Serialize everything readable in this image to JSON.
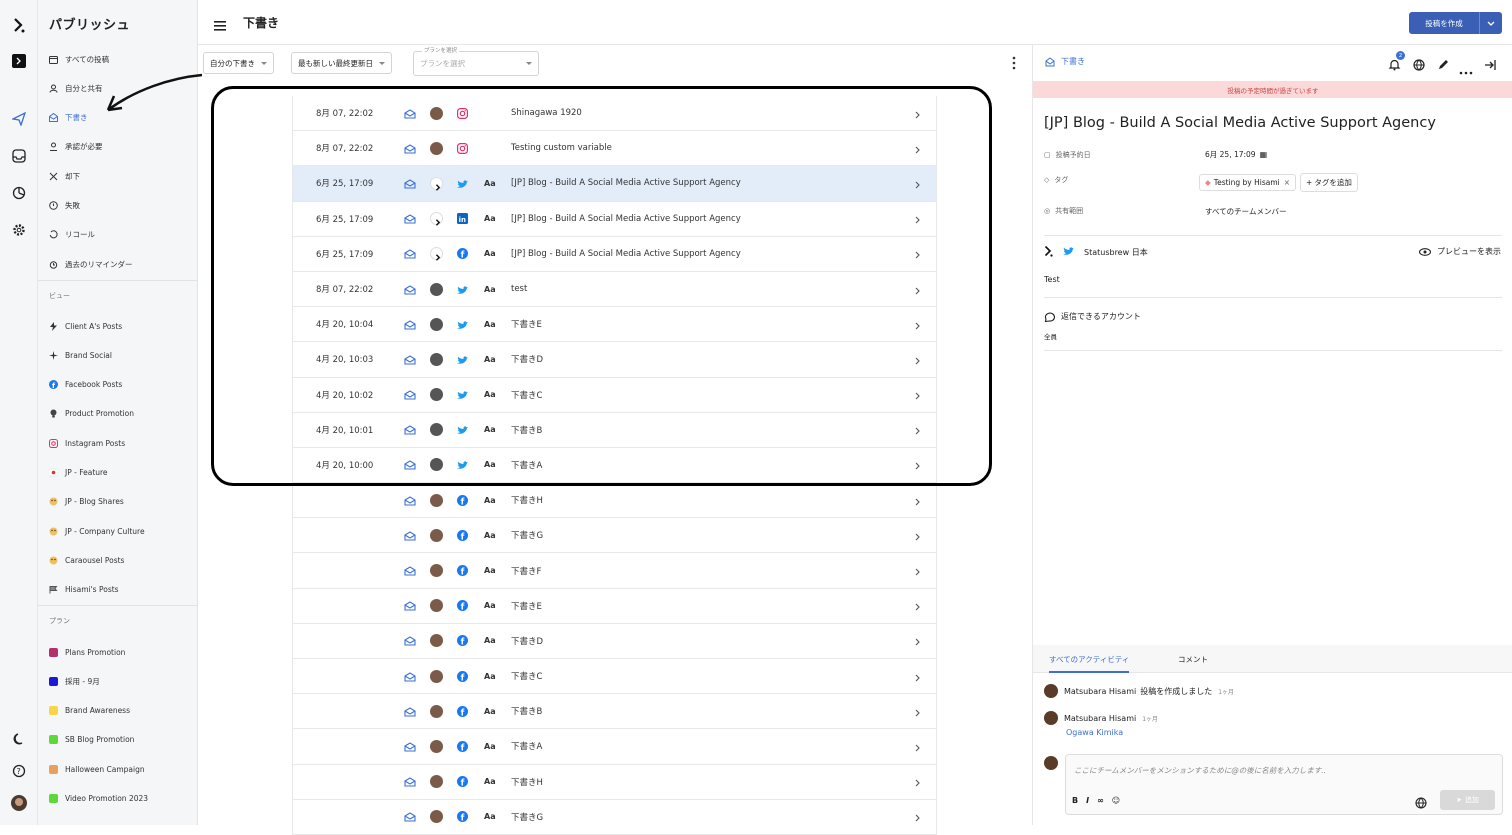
{
  "app": {
    "title": "パブリッシュ"
  },
  "rail": {
    "icons": [
      "statusbrew-logo-icon",
      "account-badge-icon",
      "paper-plane-icon",
      "inbox-icon",
      "analytics-icon",
      "settings-icon",
      "moon-icon",
      "help-icon",
      "user-avatar"
    ]
  },
  "sidebar": {
    "items": [
      {
        "label": "すべての投稿",
        "icon": "calendar-icon"
      },
      {
        "label": "自分と共有",
        "icon": "person-icon"
      },
      {
        "label": "下書き",
        "icon": "draft-icon",
        "active": true
      },
      {
        "label": "承認が必要",
        "icon": "approval-icon"
      },
      {
        "label": "却下",
        "icon": "x-icon"
      },
      {
        "label": "失敗",
        "icon": "alert-icon"
      },
      {
        "label": "リコール",
        "icon": "recall-icon"
      },
      {
        "label": "過去のリマインダー",
        "icon": "alarm-icon"
      }
    ],
    "views_heading": "ビュー",
    "views": [
      {
        "label": "Client A's Posts",
        "icon": "bolt-icon"
      },
      {
        "label": "Brand Social",
        "icon": "sparkle-icon"
      },
      {
        "label": "Facebook Posts",
        "icon": "facebook-icon"
      },
      {
        "label": "Product Promotion",
        "icon": "bulb-icon"
      },
      {
        "label": "Instagram Posts",
        "icon": "instagram-icon"
      },
      {
        "label": "JP - Feature",
        "icon": "japan-flag-icon"
      },
      {
        "label": "JP - Blog Shares",
        "icon": "emoji-icon"
      },
      {
        "label": "JP - Company Culture",
        "icon": "emoji-icon"
      },
      {
        "label": "Caraousel Posts",
        "icon": "emoji-icon"
      },
      {
        "label": "Hisami's Posts",
        "icon": "flag-icon"
      }
    ],
    "plans_heading": "プラン",
    "plans": [
      {
        "label": "Plans Promotion",
        "color": "#b3306e"
      },
      {
        "label": "採用 - 9月",
        "color": "#1a1ad6"
      },
      {
        "label": "Brand Awareness",
        "color": "#f7d44a"
      },
      {
        "label": "SB Blog Promotion",
        "color": "#5fd63a"
      },
      {
        "label": "Halloween Campaign",
        "color": "#e8a060"
      },
      {
        "label": "Video Promotion 2023",
        "color": "#5fd63a"
      }
    ]
  },
  "header": {
    "title": "下書き",
    "create_label": "投稿を作成"
  },
  "filters": {
    "mine": "自分の下書き",
    "sort": "最も新しい最終更新日",
    "plan_label": "プランを選択",
    "plan_placeholder": "プランを選択"
  },
  "rows": [
    {
      "date": "8月 07, 22:02",
      "network": "instagram",
      "aa": "",
      "title": "Shinagawa 1920",
      "avatar": "#7a5a48"
    },
    {
      "date": "8月 07, 22:02",
      "network": "instagram",
      "aa": "",
      "title": "Testing custom variable",
      "avatar": "#7a5a48"
    },
    {
      "date": "6月 25, 17:09",
      "network": "twitter",
      "aa": "Aa",
      "title": "[JP] Blog - Build A Social Media Active Support Agency",
      "avatar": "#fff",
      "selected": true
    },
    {
      "date": "6月 25, 17:09",
      "network": "linkedin",
      "aa": "Aa",
      "title": "[JP] Blog - Build A Social Media Active Support Agency",
      "avatar": "#fff"
    },
    {
      "date": "6月 25, 17:09",
      "network": "facebook",
      "aa": "Aa",
      "title": "[JP] Blog - Build A Social Media Active Support Agency",
      "avatar": "#fff"
    },
    {
      "date": "8月 07, 22:02",
      "network": "twitter",
      "aa": "Aa",
      "title": "test",
      "avatar": "#555"
    },
    {
      "date": "4月 20, 10:04",
      "network": "twitter",
      "aa": "Aa",
      "title": "下書きE",
      "avatar": "#555"
    },
    {
      "date": "4月 20, 10:03",
      "network": "twitter",
      "aa": "Aa",
      "title": "下書きD",
      "avatar": "#555"
    },
    {
      "date": "4月 20, 10:02",
      "network": "twitter",
      "aa": "Aa",
      "title": "下書きC",
      "avatar": "#555"
    },
    {
      "date": "4月 20, 10:01",
      "network": "twitter",
      "aa": "Aa",
      "title": "下書きB",
      "avatar": "#555"
    },
    {
      "date": "4月 20, 10:00",
      "network": "twitter",
      "aa": "Aa",
      "title": "下書きA",
      "avatar": "#555"
    },
    {
      "date": "",
      "network": "facebook",
      "aa": "Aa",
      "title": "下書きH",
      "avatar": "#7a5a48"
    },
    {
      "date": "",
      "network": "facebook",
      "aa": "Aa",
      "title": "下書きG",
      "avatar": "#7a5a48"
    },
    {
      "date": "",
      "network": "facebook",
      "aa": "Aa",
      "title": "下書きF",
      "avatar": "#7a5a48"
    },
    {
      "date": "",
      "network": "facebook",
      "aa": "Aa",
      "title": "下書きE",
      "avatar": "#7a5a48"
    },
    {
      "date": "",
      "network": "facebook",
      "aa": "Aa",
      "title": "下書きD",
      "avatar": "#7a5a48"
    },
    {
      "date": "",
      "network": "facebook",
      "aa": "Aa",
      "title": "下書きC",
      "avatar": "#7a5a48"
    },
    {
      "date": "",
      "network": "facebook",
      "aa": "Aa",
      "title": "下書きB",
      "avatar": "#7a5a48"
    },
    {
      "date": "",
      "network": "facebook",
      "aa": "Aa",
      "title": "下書きA",
      "avatar": "#7a5a48"
    },
    {
      "date": "",
      "network": "facebook",
      "aa": "Aa",
      "title": "下書きH",
      "avatar": "#7a5a48"
    },
    {
      "date": "",
      "network": "facebook",
      "aa": "Aa",
      "title": "下書きG",
      "avatar": "#7a5a48"
    }
  ],
  "detail": {
    "tag": "下書き",
    "notif_count": "2",
    "banner": "投稿の予定時間が過ぎています",
    "title": "[JP] Blog - Build A Social Media Active Support Agency",
    "scheduled_label": "投稿予約日",
    "scheduled_value": "6月 25, 17:09",
    "tags_label": "タグ",
    "tag_chip": "Testing by Hisami",
    "add_tag": "タグを追加",
    "share_label": "共有範囲",
    "share_value": "すべてのチームメンバー",
    "account_name": "Statusbrew 日本",
    "preview_label": "プレビューを表示",
    "body": "Test",
    "reply_label": "返信できるアカウント",
    "reply_value": "全員",
    "tab_all": "すべてのアクティビティ",
    "tab_comments": "コメント",
    "activities": [
      {
        "name": "Matsubara Hisami",
        "text": "投稿を作成しました",
        "time": "1ヶ月"
      },
      {
        "name": "Matsubara Hisami",
        "text": "",
        "time": "1ヶ月",
        "mention": "Ogawa Kimika"
      }
    ],
    "comment_placeholder": "ここにチームメンバーをメンションするために@の後に名前を入力します..",
    "add_label": "追加"
  },
  "colors": {
    "accent": "#3b6fd6",
    "primary_button": "#3a5fb4",
    "twitter": "#1d9bf0",
    "facebook": "#1877f2",
    "linkedin": "#0a66c2",
    "instagram": "#e1306c"
  }
}
